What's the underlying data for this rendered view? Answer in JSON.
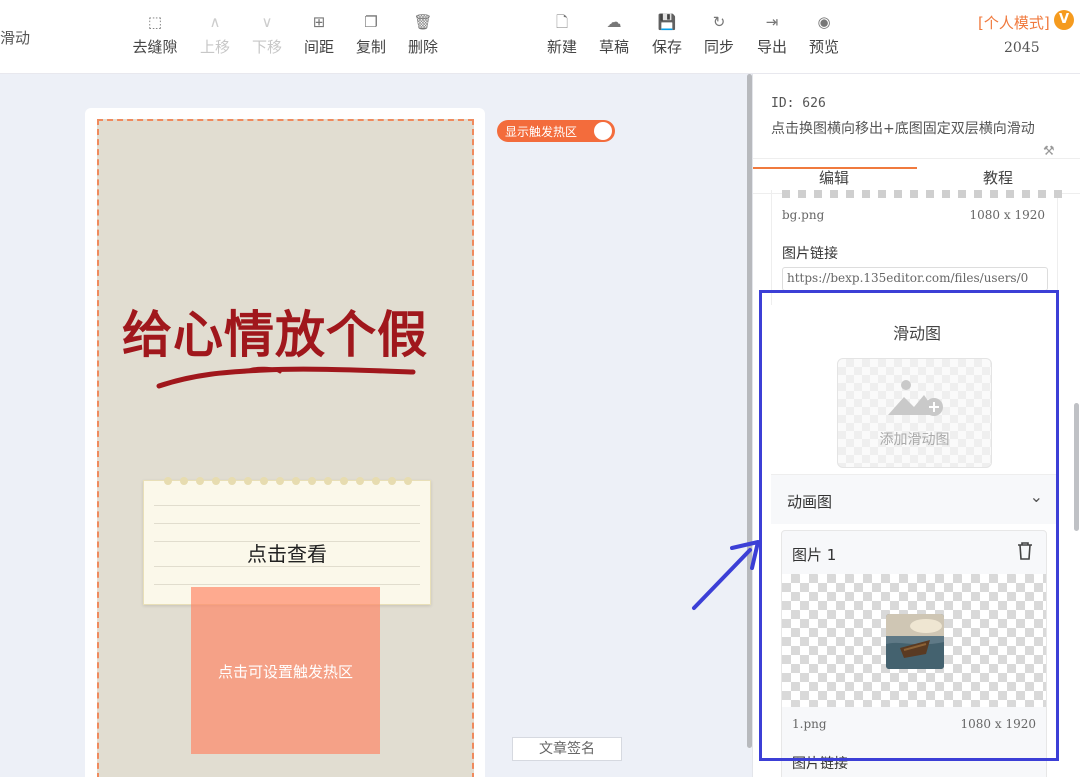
{
  "toolbar": {
    "title": "滑动",
    "left_buttons": [
      {
        "icon": "⬚",
        "label": "去缝隙"
      },
      {
        "icon": "∧",
        "label": "上移"
      },
      {
        "icon": "∨",
        "label": "下移"
      },
      {
        "icon": "⊞",
        "label": "间距"
      },
      {
        "icon": "❐",
        "label": "复制"
      },
      {
        "icon": "🗑",
        "label": "删除"
      }
    ],
    "right_buttons": [
      {
        "icon": "🗋",
        "label": "新建"
      },
      {
        "icon": "☁",
        "label": "草稿"
      },
      {
        "icon": "💾",
        "label": "保存"
      },
      {
        "icon": "↻",
        "label": "同步"
      },
      {
        "icon": "⇥",
        "label": "导出"
      },
      {
        "icon": "◉",
        "label": "预览"
      }
    ],
    "mode_label": "[个人模式]",
    "vip_badge": "V",
    "mode_number": "2045"
  },
  "canvas": {
    "headline": "给心情放个假",
    "note_text": "点击查看",
    "hotzone_text": "点击可设置触发热区",
    "toggle_label": "显示触发热区",
    "toggle_on": true,
    "signature": "文章签名"
  },
  "panel": {
    "id_text": "ID: 626",
    "description": "点击换图横向移出+底图固定双层横向滑动",
    "tool_icon": "⚒",
    "tabs": [
      "编辑",
      "教程"
    ],
    "active_tab": "编辑",
    "bg_file": {
      "name": "bg.png",
      "size": "1080 x 1920"
    },
    "link_label": "图片链接",
    "link_value": "https://bexp.135editor.com/files/users/0",
    "slide_section": "滑动图",
    "add_label": "添加滑动图",
    "anim_section": "动画图",
    "image_card": {
      "title": "图片 1",
      "name": "1.png",
      "size": "1080 x 1920",
      "link_label": "图片链接"
    }
  },
  "colors": {
    "accent": "#f07a3e",
    "headline": "#a0171c",
    "highlight": "#3c3fd6",
    "hotzone": "#ff8464"
  }
}
